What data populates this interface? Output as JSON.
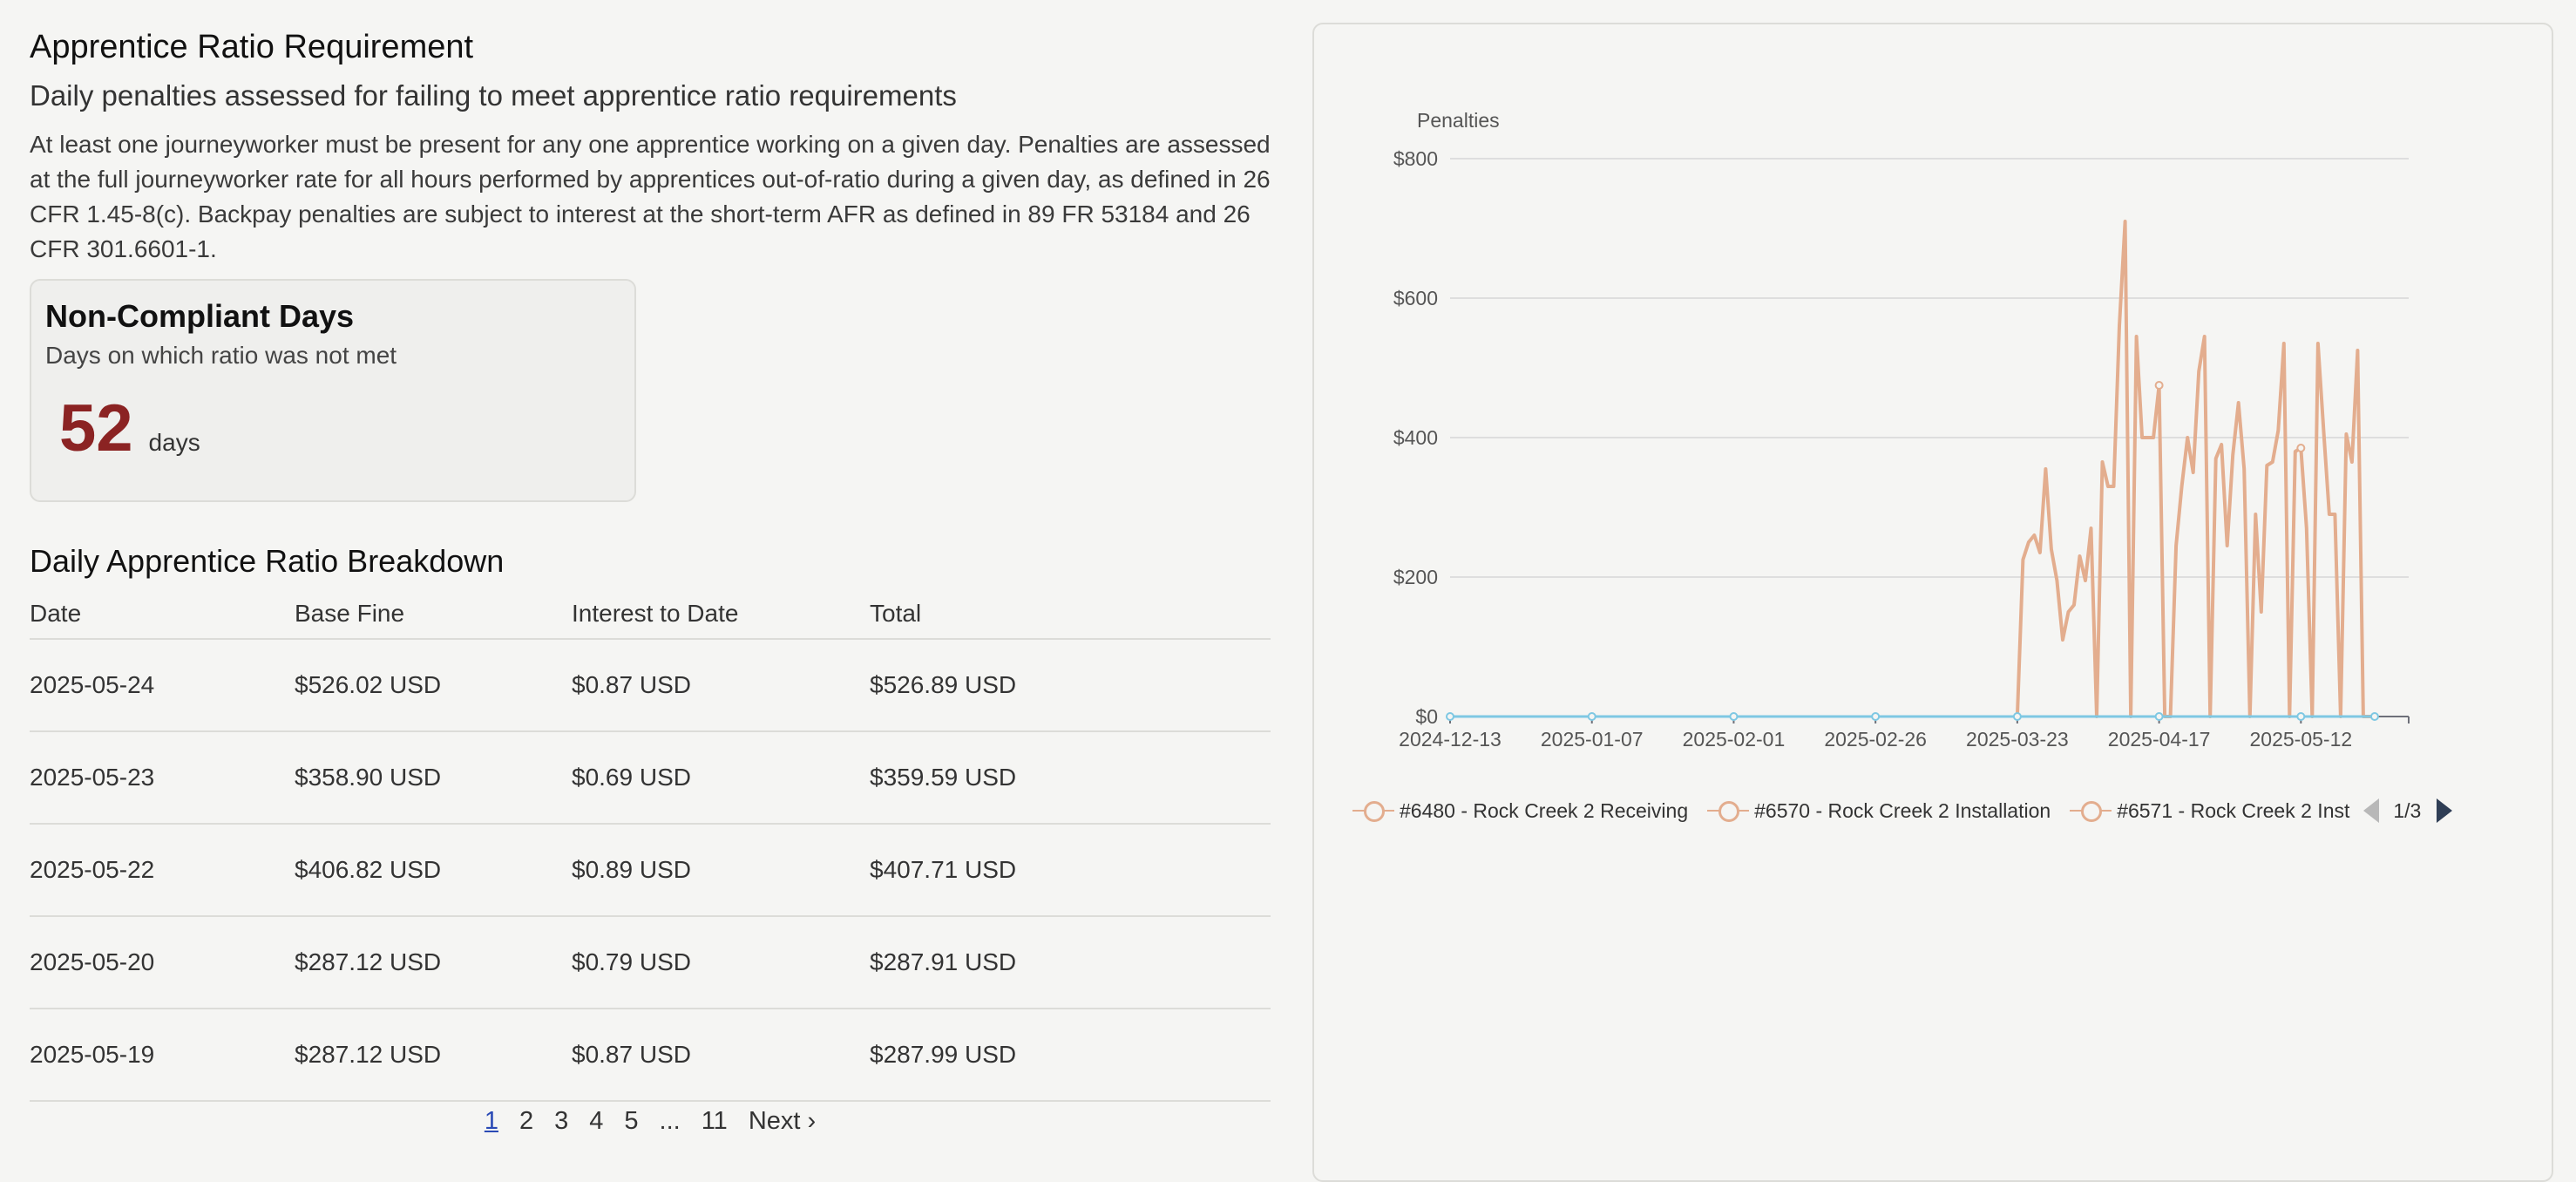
{
  "header": {
    "title": "Apprentice Ratio Requirement",
    "subtitle": "Daily penalties assessed for failing to meet apprentice ratio requirements",
    "description": "At least one journeyworker must be present for any one apprentice working on a given day. Penalties are assessed at the full journeyworker rate for all hours performed by apprentices out-of-ratio during a given day, as defined in 26 CFR 1.45-8(c). Backpay penalties are subject to interest at the short-term AFR as defined in 89 FR 53184 and 26 CFR 301.6601-1."
  },
  "summary_card": {
    "title": "Non-Compliant Days",
    "subtitle": "Days on which ratio was not met",
    "value": "52",
    "unit": "days",
    "value_color": "#8b2323"
  },
  "breakdown": {
    "title": "Daily Apprentice Ratio Breakdown",
    "columns": [
      "Date",
      "Base Fine",
      "Interest to Date",
      "Total"
    ],
    "rows": [
      [
        "2025-05-24",
        "$526.02 USD",
        "$0.87 USD",
        "$526.89 USD"
      ],
      [
        "2025-05-23",
        "$358.90 USD",
        "$0.69 USD",
        "$359.59 USD"
      ],
      [
        "2025-05-22",
        "$406.82 USD",
        "$0.89 USD",
        "$407.71 USD"
      ],
      [
        "2025-05-20",
        "$287.12 USD",
        "$0.79 USD",
        "$287.91 USD"
      ],
      [
        "2025-05-19",
        "$287.12 USD",
        "$0.87 USD",
        "$287.99 USD"
      ]
    ]
  },
  "pagination": {
    "pages": [
      "1",
      "2",
      "3",
      "4",
      "5",
      "...",
      "11"
    ],
    "current": "1",
    "next_label": "Next ›"
  },
  "chart_data": {
    "type": "line",
    "title": "",
    "ylabel": "Penalties",
    "xlabel": "",
    "ylim": [
      0,
      800
    ],
    "y_ticks": [
      "$0",
      "$200",
      "$400",
      "$600",
      "$800"
    ],
    "x_ticks": [
      "2024-12-13",
      "2025-01-07",
      "2025-02-01",
      "2025-02-26",
      "2025-03-23",
      "2025-04-17",
      "2025-05-12"
    ],
    "grid": true,
    "series": [
      {
        "name": "#6480 - Rock Creek 2 Receiving",
        "color": "#e3ad8e",
        "x": [
          "2025-03-23",
          "2025-03-24",
          "2025-03-25",
          "2025-03-26",
          "2025-03-27",
          "2025-03-28",
          "2025-03-29",
          "2025-03-30",
          "2025-03-31",
          "2025-04-01",
          "2025-04-02",
          "2025-04-03",
          "2025-04-04",
          "2025-04-05",
          "2025-04-06",
          "2025-04-07",
          "2025-04-08",
          "2025-04-09",
          "2025-04-10",
          "2025-04-11",
          "2025-04-12",
          "2025-04-13",
          "2025-04-14",
          "2025-04-15",
          "2025-04-16",
          "2025-04-17",
          "2025-04-18",
          "2025-04-19",
          "2025-04-20",
          "2025-04-21",
          "2025-04-22",
          "2025-04-23",
          "2025-04-24",
          "2025-04-25",
          "2025-04-26",
          "2025-04-27",
          "2025-04-28",
          "2025-04-29",
          "2025-04-30",
          "2025-05-01",
          "2025-05-02",
          "2025-05-03",
          "2025-05-04",
          "2025-05-05",
          "2025-05-06",
          "2025-05-07",
          "2025-05-08",
          "2025-05-09",
          "2025-05-10",
          "2025-05-11",
          "2025-05-12",
          "2025-05-13",
          "2025-05-14",
          "2025-05-15",
          "2025-05-16",
          "2025-05-17",
          "2025-05-18",
          "2025-05-19",
          "2025-05-20",
          "2025-05-21",
          "2025-05-22",
          "2025-05-23",
          "2025-05-24",
          "2025-05-25"
        ],
        "y": [
          0,
          225,
          250,
          260,
          235,
          355,
          240,
          195,
          110,
          150,
          160,
          230,
          195,
          270,
          0,
          365,
          330,
          330,
          560,
          710,
          0,
          545,
          400,
          400,
          400,
          475,
          0,
          0,
          245,
          330,
          400,
          350,
          495,
          545,
          0,
          370,
          390,
          245,
          375,
          450,
          355,
          0,
          290,
          150,
          360,
          365,
          410,
          535,
          0,
          380,
          385,
          270,
          0,
          535,
          410,
          290,
          290,
          0,
          405,
          365,
          525,
          0,
          0,
          0
        ]
      },
      {
        "name": "#6570 - Rock Creek 2 Installation",
        "color": "#e3ad8e",
        "x": [],
        "y": []
      },
      {
        "name": "#6571 - Rock Creek 2 Inst",
        "color": "#e3ad8e",
        "x": [],
        "y": []
      },
      {
        "name": "",
        "color": "#7ec8e3",
        "x": [
          "2024-12-13",
          "2025-01-07",
          "2025-02-01",
          "2025-02-26",
          "2025-03-23",
          "2025-04-17",
          "2025-05-12",
          "2025-05-25"
        ],
        "y": [
          0,
          0,
          0,
          0,
          0,
          0,
          0,
          0
        ]
      }
    ],
    "x_start": "2024-12-13",
    "x_end": "2025-05-31"
  },
  "legend": {
    "page_indicator": "1/3"
  }
}
